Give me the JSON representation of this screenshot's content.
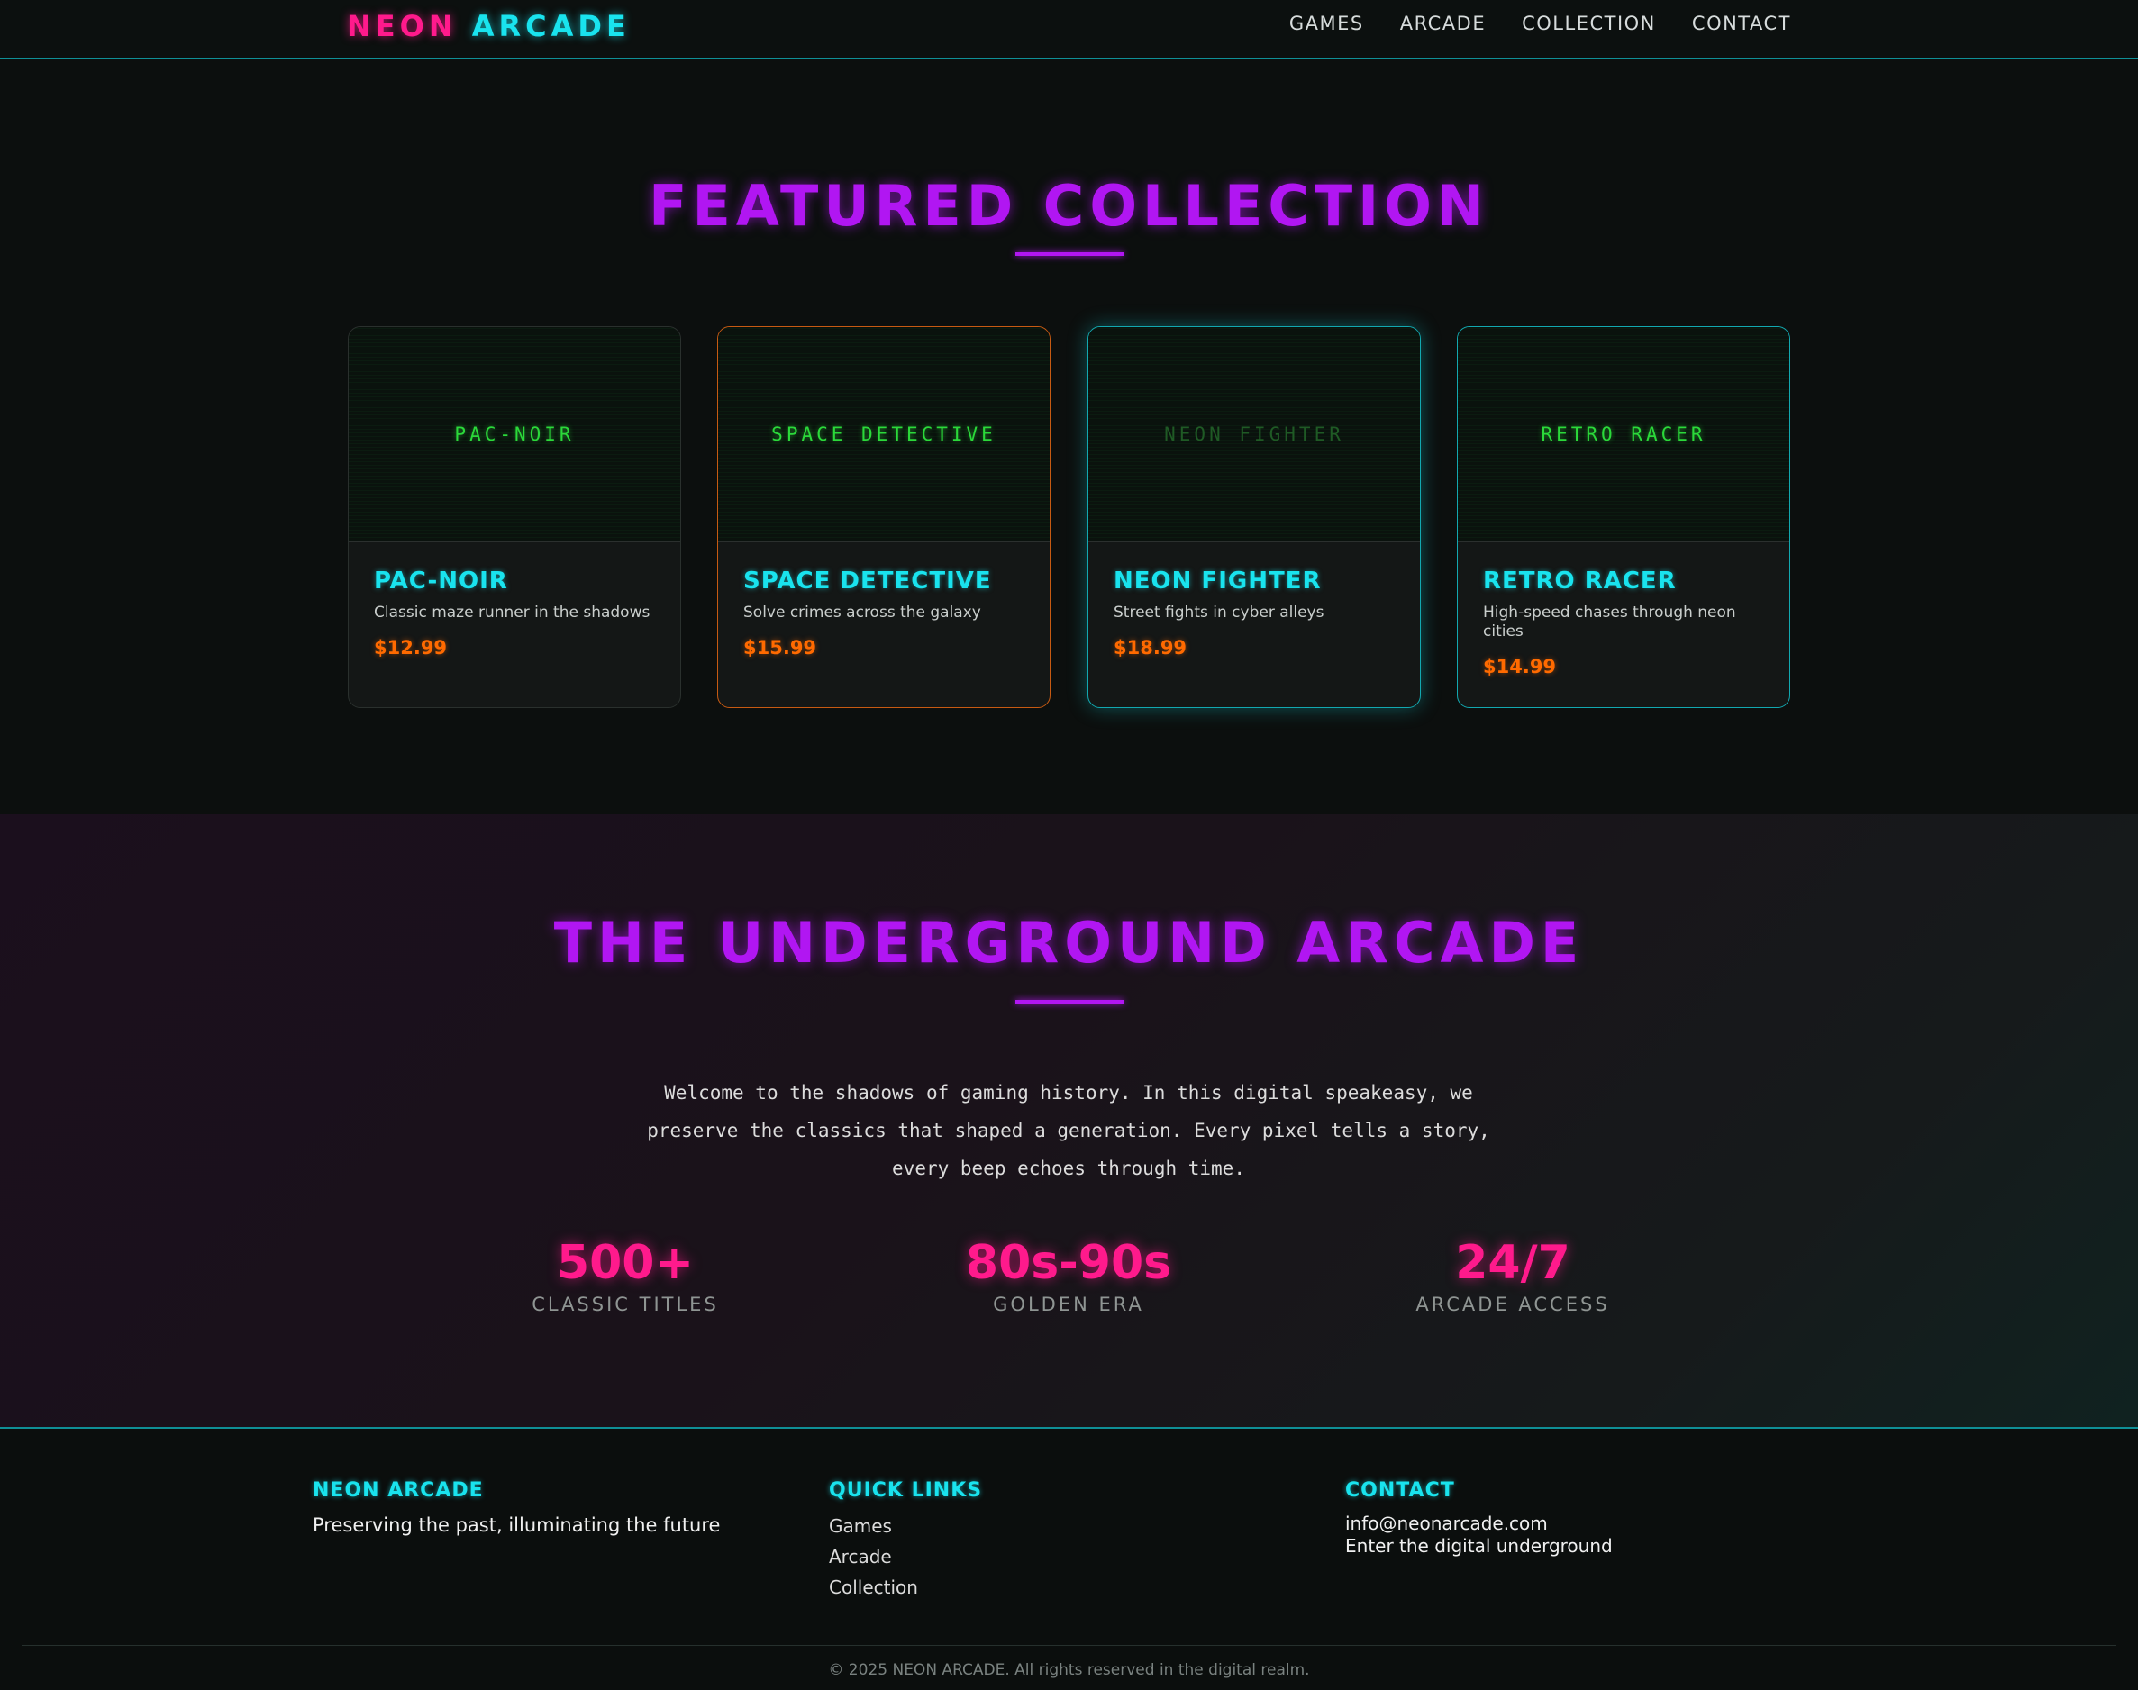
{
  "nav": {
    "logo_part1": "NEON",
    "logo_part2": "ARCADE",
    "links": [
      "GAMES",
      "ARCADE",
      "COLLECTION",
      "CONTACT"
    ]
  },
  "featured": {
    "title": "FEATURED COLLECTION",
    "cards": [
      {
        "screen": "PAC-NOIR",
        "title": "PAC-NOIR",
        "desc": "Classic maze runner in the shadows",
        "price": "$12.99"
      },
      {
        "screen": "SPACE DETECTIVE",
        "title": "SPACE DETECTIVE",
        "desc": "Solve crimes across the galaxy",
        "price": "$15.99"
      },
      {
        "screen": "NEON FIGHTER",
        "title": "NEON FIGHTER",
        "desc": "Street fights in cyber alleys",
        "price": "$18.99"
      },
      {
        "screen": "RETRO RACER",
        "title": "RETRO RACER",
        "desc": "High-speed chases through neon cities",
        "price": "$14.99"
      }
    ]
  },
  "underground": {
    "title": "THE UNDERGROUND ARCADE",
    "intro": "Welcome to the shadows of gaming history. In this digital speakeasy, we preserve the classics that shaped a generation. Every pixel tells a story, every beep echoes through time.",
    "stats": [
      {
        "value": "500+",
        "label": "CLASSIC TITLES"
      },
      {
        "value": "80s-90s",
        "label": "GOLDEN ERA"
      },
      {
        "value": "24/7",
        "label": "ARCADE ACCESS"
      }
    ]
  },
  "footer": {
    "brand_heading": "NEON ARCADE",
    "tagline": "Preserving the past, illuminating the future",
    "links_heading": "QUICK LINKS",
    "links": [
      "Games",
      "Arcade",
      "Collection"
    ],
    "contact_heading": "CONTACT",
    "email": "info@neonarcade.com",
    "contact_line": "Enter the digital underground",
    "copyright": "© 2025 NEON ARCADE. All rights reserved in the digital realm."
  },
  "colors": {
    "magenta": "#ff1a8c",
    "cyan": "#19e3ee",
    "purple": "#b116f2",
    "orange": "#ff6a00",
    "terminal_green": "#2bd93a"
  }
}
